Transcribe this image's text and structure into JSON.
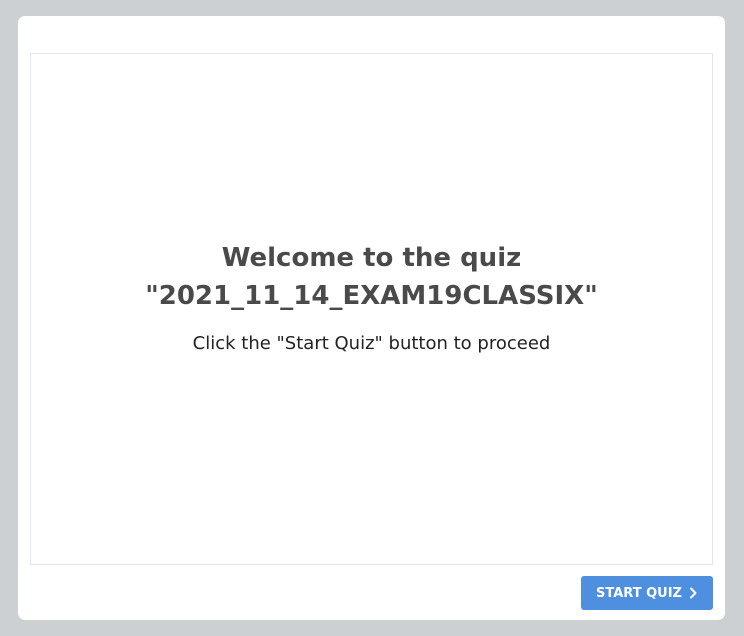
{
  "quiz": {
    "welcome_line1": "Welcome to the quiz",
    "welcome_line2": "\"2021_11_14_EXAM19CLASSIX\"",
    "instructions": "Click the \"Start Quiz\" button to proceed"
  },
  "footer": {
    "start_label": "START QUIZ",
    "start_icon": "chevron-right-icon"
  },
  "colors": {
    "background": "#cdd0d3",
    "card": "#ffffff",
    "accent": "#4f8fe0",
    "title_text": "#4a4a4a"
  }
}
